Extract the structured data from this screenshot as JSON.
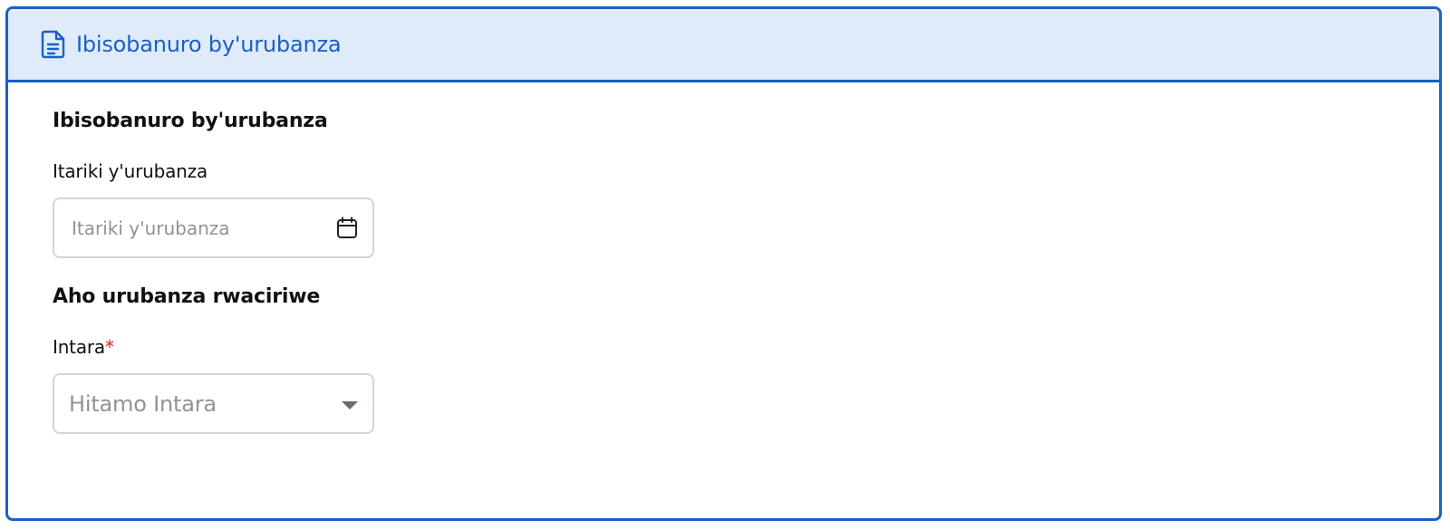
{
  "header": {
    "title": "Ibisobanuro by'urubanza",
    "icon": "document-icon",
    "accent_color": "#1b5fc8",
    "background_color": "#dfebf8"
  },
  "section_details": {
    "title": "Ibisobanuro by'urubanza",
    "date_field": {
      "label": "Itariki y'urubanza",
      "placeholder": "Itariki y'urubanza",
      "value": "",
      "icon": "calendar-icon"
    }
  },
  "section_location": {
    "title": "Aho urubanza rwaciriwe",
    "province_field": {
      "label": "Intara",
      "required_marker": "*",
      "selected": "Hitamo Intara",
      "icon": "chevron-down-icon"
    }
  }
}
